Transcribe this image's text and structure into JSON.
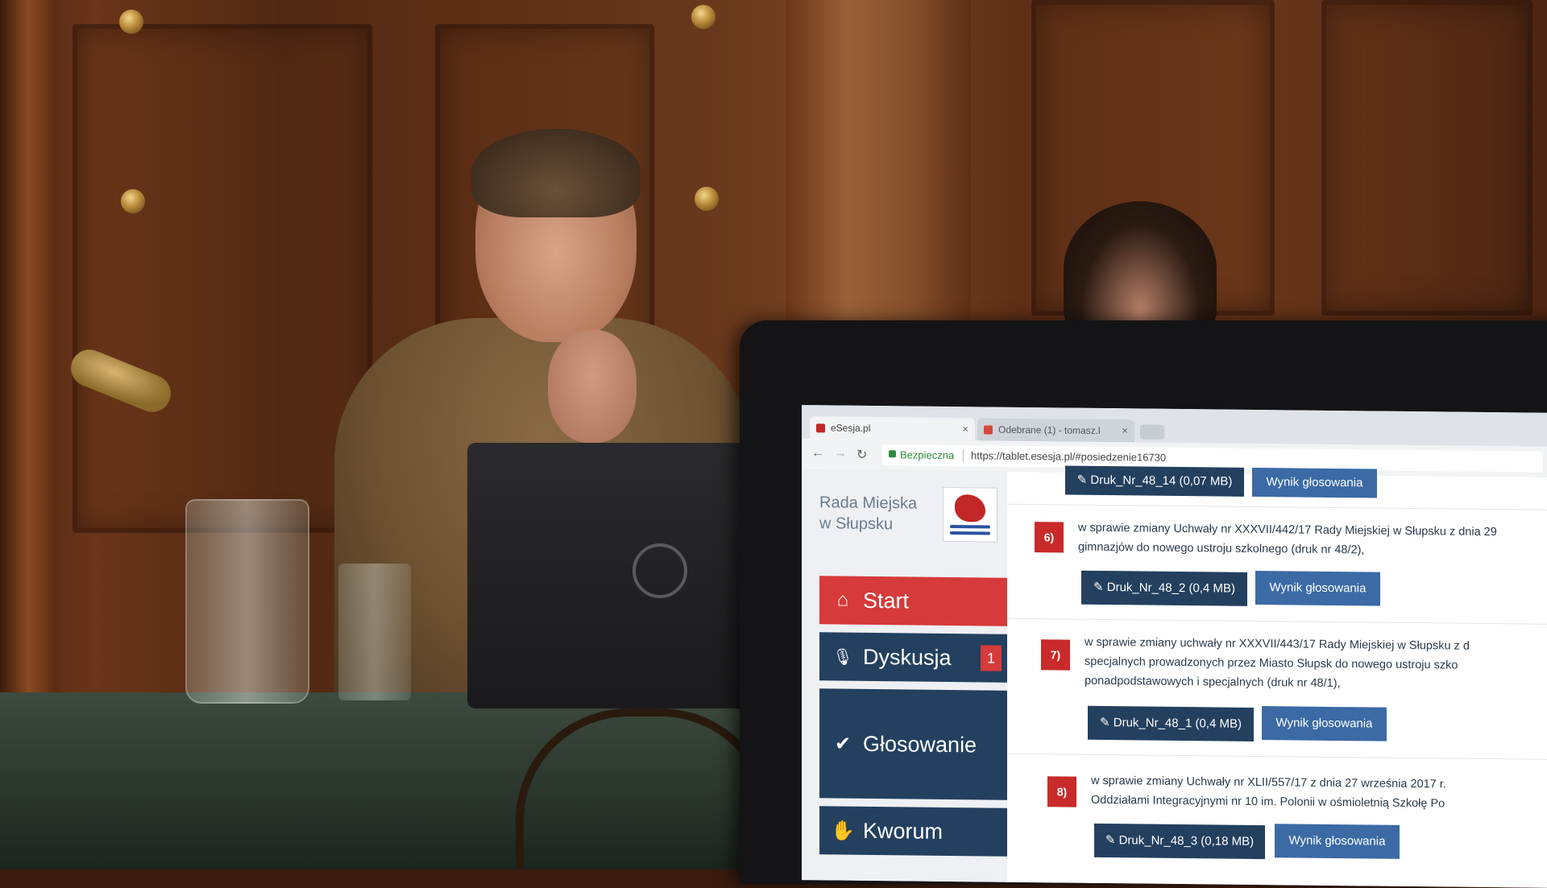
{
  "browser": {
    "tabs": [
      {
        "title": "eSesja.pl",
        "close": "×"
      },
      {
        "title": "Odebrane (1) - tomasz.l",
        "close": "×"
      }
    ],
    "secure_label": "Bezpieczna",
    "url": "https://tablet.esesja.pl/#posiedzenie16730"
  },
  "sidebar": {
    "brand_line1": "Rada Miejska",
    "brand_line2": "w Słupsku",
    "menu": [
      {
        "label": "Start",
        "icon": "home-icon",
        "glyph": "⌂"
      },
      {
        "label": "Dyskusja",
        "icon": "microphone-icon",
        "glyph": "🎙",
        "badge": "1"
      },
      {
        "label": "Głosowanie",
        "icon": "checkmark-icon",
        "glyph": "✔"
      },
      {
        "label": "Kworum",
        "icon": "hand-icon",
        "glyph": "✋"
      }
    ]
  },
  "content": {
    "top_row": {
      "attachment": "Druk_Nr_48_14 (0,07 MB)",
      "result": "Wynik głosowania"
    },
    "items": [
      {
        "number": "6)",
        "line1": "w sprawie zmiany Uchwały nr XXXVII/442/17 Rady Miejskiej w Słupsku z dnia 29",
        "line2": "gimnazjów do nowego ustroju szkolnego (druk nr 48/2),",
        "line3": "",
        "attachment": "Druk_Nr_48_2 (0,4 MB)",
        "result": "Wynik głosowania"
      },
      {
        "number": "7)",
        "line1": "w sprawie zmiany uchwały nr XXXVII/443/17 Rady Miejskiej w Słupsku z d",
        "line2": "specjalnych prowadzonych przez Miasto Słupsk do nowego ustroju szko",
        "line3": "ponadpodstawowych i specjalnych (druk nr 48/1),",
        "attachment": "Druk_Nr_48_1 (0,4 MB)",
        "result": "Wynik głosowania"
      },
      {
        "number": "8)",
        "line1": "w sprawie zmiany Uchwały nr XLII/557/17 z dnia 27 września 2017 r.",
        "line2": "Oddziałami Integracyjnymi nr 10 im. Polonii w ośmioletnią Szkołę Po",
        "line3": "",
        "attachment": "Druk_Nr_48_3 (0,18 MB)",
        "result": "Wynik głosowania"
      }
    ]
  },
  "colors": {
    "start_red": "#d63a3a",
    "menu_navy": "#24405f",
    "result_blue": "#3b6aa5",
    "number_red": "#c92a2a"
  }
}
